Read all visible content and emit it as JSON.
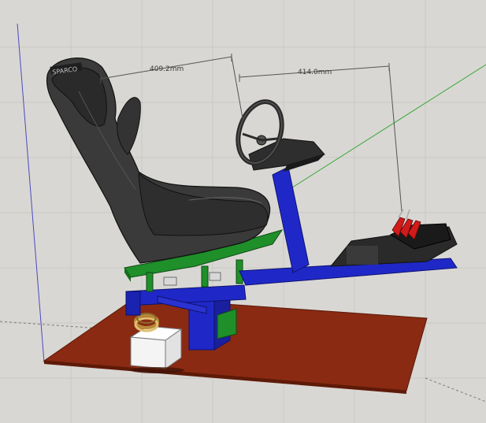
{
  "scene": {
    "dimensions": [
      {
        "label": "409.2mm"
      },
      {
        "label": "414.0mm"
      }
    ],
    "seat_brand_text": "SPARCO",
    "colors": {
      "background": "#d9d7d4",
      "grid": "#c9c7c4",
      "floor": "#8a2a12",
      "frame_blue": "#1f28c7",
      "frame_green": "#1f8f2a",
      "seat": "#3a3a3a",
      "pedal_red": "#d11a1a",
      "cube": "#f4f4f4",
      "axis_green": "#4aa84a",
      "axis_blue": "#3a3aa8"
    }
  }
}
